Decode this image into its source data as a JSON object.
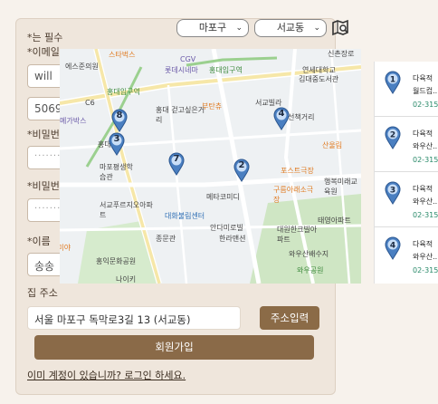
{
  "topbar": {
    "district_select": "마포구",
    "dong_select": "서교동",
    "map_search_icon": "map-search-icon"
  },
  "form": {
    "required_note": "*는 필수",
    "email_label": "*이메일",
    "email_value": "will",
    "phone_value": "5069",
    "password_label": "*비밀번",
    "password_value": "·······",
    "password_confirm_label": "*비밀번",
    "password_confirm_value": "·······",
    "name_label": "*이름",
    "name_value": "송송",
    "address_label": "집 주소",
    "address_value": "서울 마포구 독막로3길 13 (서교동)",
    "address_button": "주소입력",
    "signup_button": "회원가입",
    "login_link": "이미 계정이 있습니까? 로그인 하세요."
  },
  "map": {
    "labels": [
      "스타벅스",
      "에스준의원",
      "CGV",
      "롯데시네마",
      "홍대입구역",
      "신촌장로",
      "연세대학교",
      "김대중도서관",
      "홍대입구역",
      "C6",
      "메가박스",
      "홍대 걷고싶은거리",
      "부탄츄",
      "서교빌라",
      "선책거리",
      "산울림",
      "홍대",
      "마포평생학습관",
      "구름아래소극장",
      "포스트극장",
      "행복미래교육원",
      "서교푸르지오아파트",
      "대화불림센터",
      "메타코미디",
      "태영아파트",
      "안다미로빌",
      "한라맨션",
      "대원한크빌아파트",
      "종문관",
      "카미야",
      "홍익문화공원",
      "와우산배수지",
      "와우공원",
      "나이키"
    ],
    "pins": [
      "1",
      "2",
      "3",
      "4",
      "7",
      "8"
    ]
  },
  "results": [
    {
      "num": "1",
      "name": "다육적",
      "sub": "월드컵..",
      "phone": "02-315"
    },
    {
      "num": "2",
      "name": "다육적",
      "sub": "와우산..",
      "phone": "02-315"
    },
    {
      "num": "3",
      "name": "다육적",
      "sub": "와우산..",
      "phone": "02-315"
    },
    {
      "num": "4",
      "name": "다육적",
      "sub": "와우산..",
      "phone": "02-315"
    }
  ],
  "colors": {
    "accent": "#8a6a48",
    "pin": "#4a7fc1",
    "phone": "#2a8a6a"
  }
}
